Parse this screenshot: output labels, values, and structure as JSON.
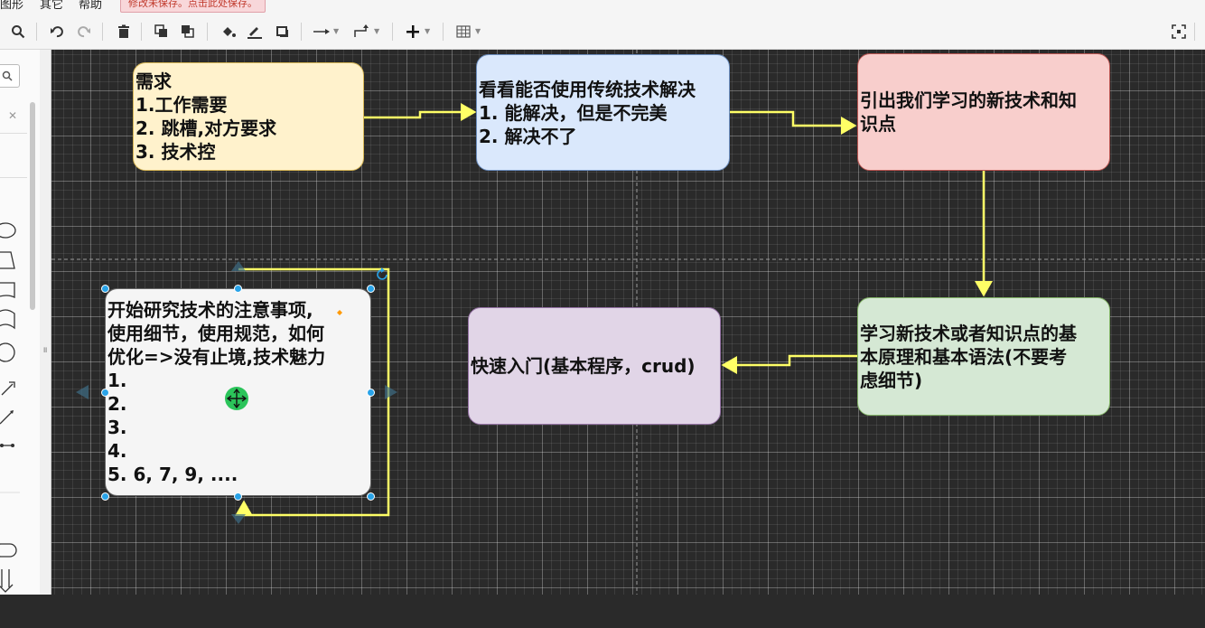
{
  "menu": {
    "items": [
      "图形",
      "其它",
      "帮助"
    ],
    "save_notice": "修改未保存。点击此处保存。"
  },
  "toolbar": {
    "icons": [
      "zoom-icon",
      "undo-icon",
      "redo-icon",
      "delete-icon",
      "to-front-icon",
      "to-back-icon",
      "fill-color-icon",
      "line-color-icon",
      "shadow-icon",
      "connection-icon",
      "waypoints-icon",
      "insert-icon",
      "table-icon",
      "fullscreen-icon"
    ]
  },
  "sidebar": {
    "shapes": [
      "ellipse",
      "parallelogram",
      "document",
      "tape",
      "circle",
      "arrow",
      "line",
      "connector",
      "rounded",
      "cylinder"
    ]
  },
  "nodes": {
    "need": {
      "lines": [
        "需求",
        "1.工作需要",
        "2. 跳槽,对方要求",
        "3. 技术控"
      ],
      "fill": "#fff2cc",
      "stroke": "#d6b656"
    },
    "traditional": {
      "lines": [
        "看看能否使用传统技术解决",
        "1. 能解决，但是不完美",
        "2. 解决不了"
      ],
      "fill": "#dae8fc",
      "stroke": "#6c8ebf"
    },
    "new_tech": {
      "lines": [
        "引出我们学习的新技术和知",
        "识点"
      ],
      "fill": "#f8cecc",
      "stroke": "#b85450"
    },
    "learn_basics": {
      "lines": [
        "学习新技术或者知识点的基",
        "本原理和基本语法(不要考",
        "虑细节)"
      ],
      "fill": "#d5e8d4",
      "stroke": "#82b366"
    },
    "quick_start": {
      "lines": [
        "快速入门(基本程序，crud)"
      ],
      "fill": "#e1d5e7",
      "stroke": "#9673a6"
    },
    "research": {
      "lines": [
        "开始研究技术的注意事项,",
        "使用细节，使用规范，如何",
        "优化=>没有止境,技术魅力",
        "1.",
        "2.",
        "3.",
        "4.",
        "5. 6, 7, 9, ...."
      ],
      "fill": "#f5f5f5",
      "stroke": "#666666"
    }
  },
  "colors": {
    "connector": "#ffff66",
    "selection": "#29a3e8",
    "move_handle": "#2bc45a"
  }
}
